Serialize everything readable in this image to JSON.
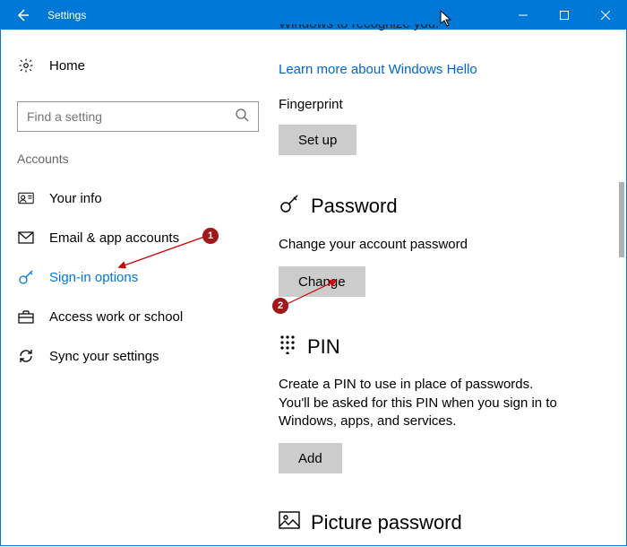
{
  "titlebar": {
    "title": "Settings"
  },
  "sidebar": {
    "home": "Home",
    "search_placeholder": "Find a setting",
    "section": "Accounts",
    "items": [
      {
        "label": "Your info"
      },
      {
        "label": "Email & app accounts"
      },
      {
        "label": "Sign-in options"
      },
      {
        "label": "Access work or school"
      },
      {
        "label": "Sync your settings"
      }
    ]
  },
  "content": {
    "truncated_top": "Windows to recognize you.",
    "hello_link": "Learn more about Windows Hello",
    "fingerprint_label": "Fingerprint",
    "fingerprint_button": "Set up",
    "password_title": "Password",
    "password_desc": "Change your account password",
    "password_button": "Change",
    "pin_title": "PIN",
    "pin_desc": "Create a PIN to use in place of passwords. You'll be asked for this PIN when you sign in to Windows, apps, and services.",
    "pin_button": "Add",
    "picture_title": "Picture password"
  },
  "annotations": {
    "badge1": "1",
    "badge2": "2"
  }
}
